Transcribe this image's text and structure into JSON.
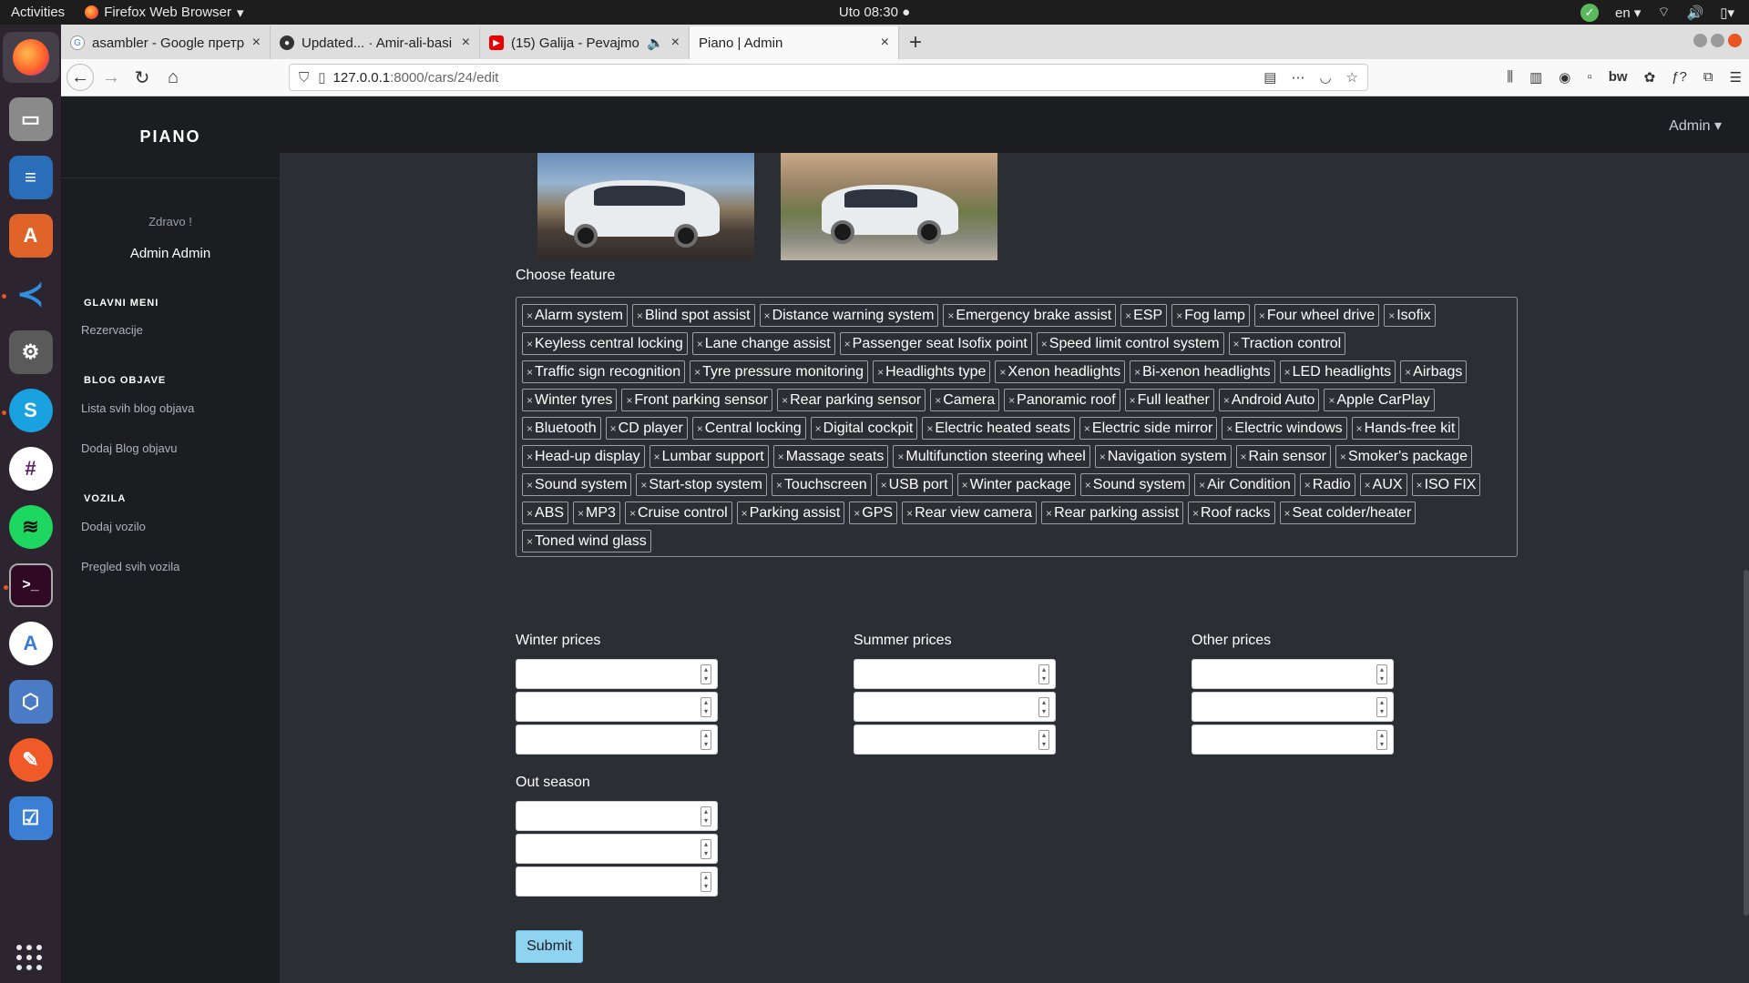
{
  "os": {
    "activities": "Activities",
    "app_name": "Firefox Web Browser",
    "clock": "Uto 08:30",
    "language": "en"
  },
  "browser": {
    "tabs": [
      {
        "label": "asambler - Google претр",
        "icon": "google-icon"
      },
      {
        "label": "Updated... · Amir-ali-basi",
        "icon": "github-icon"
      },
      {
        "label": "(15) Galija - Pevajmo (",
        "icon": "youtube-icon"
      },
      {
        "label": "Piano | Admin",
        "icon": "none"
      }
    ],
    "url_host": "127.0.0.1",
    "url_rest": ":8000/cars/24/edit"
  },
  "sidebar": {
    "brand": "PIANO",
    "greeting": "Zdravo !",
    "user_name": "Admin Admin",
    "sections": [
      {
        "heading": "GLAVNI MENI",
        "items": [
          "Rezervacije"
        ]
      },
      {
        "heading": "BLOG OBJAVE",
        "items": [
          "Lista svih blog objava",
          "Dodaj Blog objavu"
        ]
      },
      {
        "heading": "VOZILA",
        "items": [
          "Dodaj vozilo",
          "Pregled svih vozila"
        ]
      }
    ]
  },
  "header": {
    "admin_menu": "Admin ▾"
  },
  "form": {
    "feature_label": "Choose feature",
    "features": [
      "Alarm system",
      "Blind spot assist",
      "Distance warning system",
      "Emergency brake assist",
      "ESP",
      "Fog lamp",
      "Four wheel drive",
      "Isofix",
      "Keyless central locking",
      "Lane change assist",
      "Passenger seat Isofix point",
      "Speed limit control system",
      "Traction control",
      "Traffic sign recognition",
      "Tyre pressure monitoring",
      "Headlights type",
      "Xenon headlights",
      "Bi-xenon headlights",
      "LED headlights",
      "Airbags",
      "Winter tyres",
      "Front parking sensor",
      "Rear parking sensor",
      "Camera",
      "Panoramic roof",
      "Full leather",
      "Android Auto",
      "Apple CarPlay",
      "Bluetooth",
      "CD player",
      "Central locking",
      "Digital cockpit",
      "Electric heated seats",
      "Electric side mirror",
      "Electric windows",
      "Hands-free kit",
      "Head-up display",
      "Lumbar support",
      "Massage seats",
      "Multifunction steering wheel",
      "Navigation system",
      "Rain sensor",
      "Smoker's package",
      "Sound system",
      "Start-stop system",
      "Touchscreen",
      "USB port",
      "Winter package",
      "Sound system",
      "Air Condition",
      "Radio",
      "AUX",
      "ISO FIX",
      "ABS",
      "MP3",
      "Cruise control",
      "Parking assist",
      "GPS",
      "Rear view camera",
      "Rear parking assist",
      "Roof racks",
      "Seat colder/heater",
      "Toned wind glass"
    ],
    "winter_label": "Winter prices",
    "summer_label": "Summer prices",
    "other_label": "Other prices",
    "out_season_label": "Out season",
    "submit_label": "Submit"
  }
}
